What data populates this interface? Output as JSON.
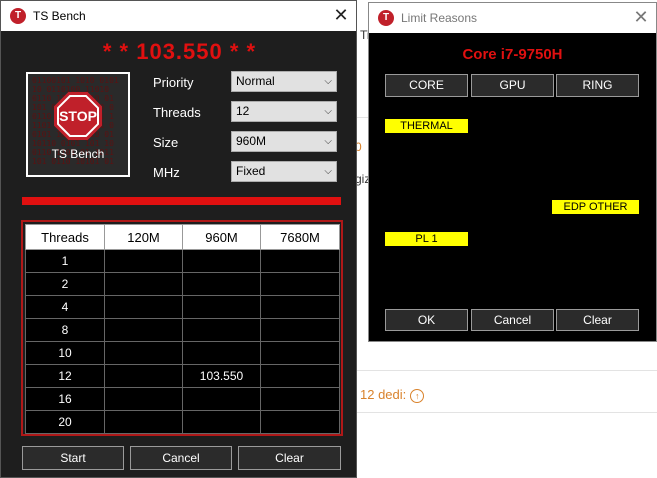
{
  "background": {
    "fragment_1": "Ti",
    "fragment_2": "0",
    "fragment_3": "giz",
    "quote_text": "12 dedi:",
    "quote_icon": "arrow-up-circle-icon"
  },
  "ts_bench": {
    "title": "TS Bench",
    "app_icon": "T",
    "close_icon": "✕",
    "score_display": "* * 103.550 * *",
    "logo_caption": "TS Bench",
    "logo_stop_text": "STOP",
    "fields": [
      {
        "label": "Priority",
        "value": "Normal"
      },
      {
        "label": "Threads",
        "value": "12"
      },
      {
        "label": "Size",
        "value": "960M"
      },
      {
        "label": "MHz",
        "value": "Fixed"
      }
    ],
    "table": {
      "headers": [
        "Threads",
        "120M",
        "960M",
        "7680M"
      ],
      "rows": [
        [
          "1",
          "",
          "",
          ""
        ],
        [
          "2",
          "",
          "",
          ""
        ],
        [
          "4",
          "",
          "",
          ""
        ],
        [
          "8",
          "",
          "",
          ""
        ],
        [
          "10",
          "",
          "",
          ""
        ],
        [
          "12",
          "",
          "103.550",
          ""
        ],
        [
          "16",
          "",
          "",
          ""
        ],
        [
          "20",
          "",
          "",
          ""
        ]
      ]
    },
    "buttons": {
      "start": "Start",
      "cancel": "Cancel",
      "clear": "Clear"
    }
  },
  "limit_reasons": {
    "title": "Limit Reasons",
    "app_icon": "T",
    "close_icon": "✕",
    "cpu_name": "Core i7-9750H",
    "tabs": [
      "CORE",
      "GPU",
      "RING"
    ],
    "reasons": {
      "thermal": "THERMAL",
      "edp_other": "EDP OTHER",
      "pl1": "PL 1"
    },
    "buttons": {
      "ok": "OK",
      "cancel": "Cancel",
      "clear": "Clear"
    }
  },
  "colors": {
    "accent_red": "#e01010",
    "reason_yellow": "#ffff00",
    "window_bg": "#1e1e1e"
  }
}
